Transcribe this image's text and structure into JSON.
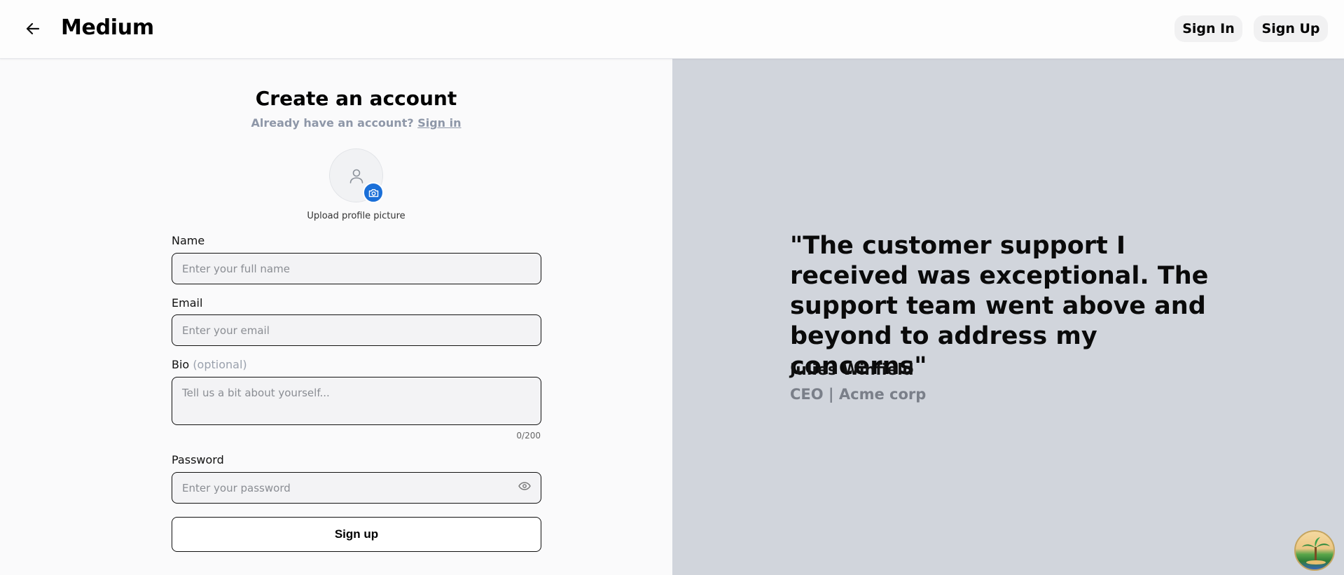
{
  "header": {
    "brand": "Medium",
    "sign_in_label": "Sign In",
    "sign_up_label": "Sign Up"
  },
  "form": {
    "title": "Create an account",
    "already_text": "Already have an account?",
    "sign_in_link": "Sign in",
    "upload_label": "Upload profile picture",
    "name": {
      "label": "Name",
      "placeholder": "Enter your full name"
    },
    "email": {
      "label": "Email",
      "placeholder": "Enter your email"
    },
    "bio": {
      "label": "Bio",
      "optional_text": "(optional)",
      "placeholder": "Tell us a bit about yourself...",
      "counter": "0/200"
    },
    "password": {
      "label": "Password",
      "placeholder": "Enter your password"
    },
    "submit_label": "Sign up"
  },
  "testimonial": {
    "quote": "\"The customer support I received was exceptional. The support team went above and beyond to address my concerns\"",
    "author": "Julies Winfield",
    "role": "CEO | Acme corp"
  },
  "colors": {
    "accent": "#1a6fd8",
    "right_panel_bg": "#d1d5dc",
    "muted_text": "#8e97a8"
  },
  "icons": [
    "arrow-left-icon",
    "user-icon",
    "camera-icon",
    "eye-icon"
  ]
}
